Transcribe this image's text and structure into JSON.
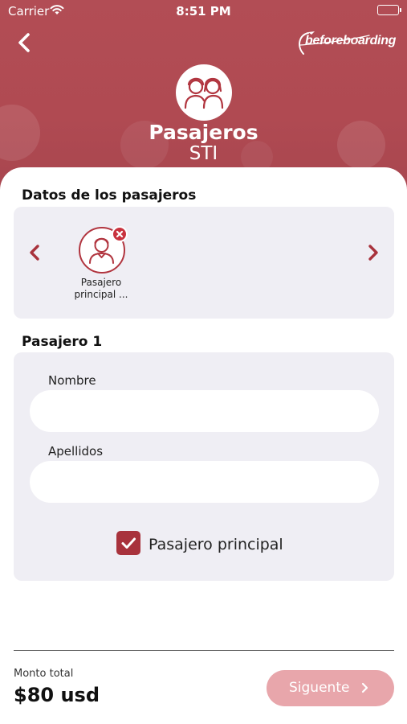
{
  "status_bar": {
    "carrier": "Carrier",
    "time": "8:51 PM"
  },
  "header": {
    "brand": "beforeboarding",
    "title": "Pasajeros",
    "subtitle": "STI"
  },
  "passengers_section": {
    "title": "Datos de los pasajeros",
    "passengers": [
      {
        "label": "Pasajero principal ..."
      }
    ]
  },
  "form": {
    "title": "Pasajero 1",
    "fields": {
      "nombre": {
        "label": "Nombre",
        "value": "",
        "placeholder": ""
      },
      "apellidos": {
        "label": "Apellidos",
        "value": "",
        "placeholder": ""
      }
    },
    "principal_checkbox": {
      "label": "Pasajero principal",
      "checked": true
    }
  },
  "footer": {
    "total_label": "Monto total",
    "total_amount": "$80 usd",
    "next_label": "Siguente"
  },
  "colors": {
    "accent": "#b1353f",
    "header_bg": "#b04a52",
    "button_disabled": "#e8a6ab",
    "card_bg": "#efeef4"
  },
  "icons": {
    "back": "chevron-left-icon",
    "avatar": "couple-icon",
    "passenger": "person-icon",
    "remove": "close-icon",
    "next": "chevron-right-icon"
  }
}
